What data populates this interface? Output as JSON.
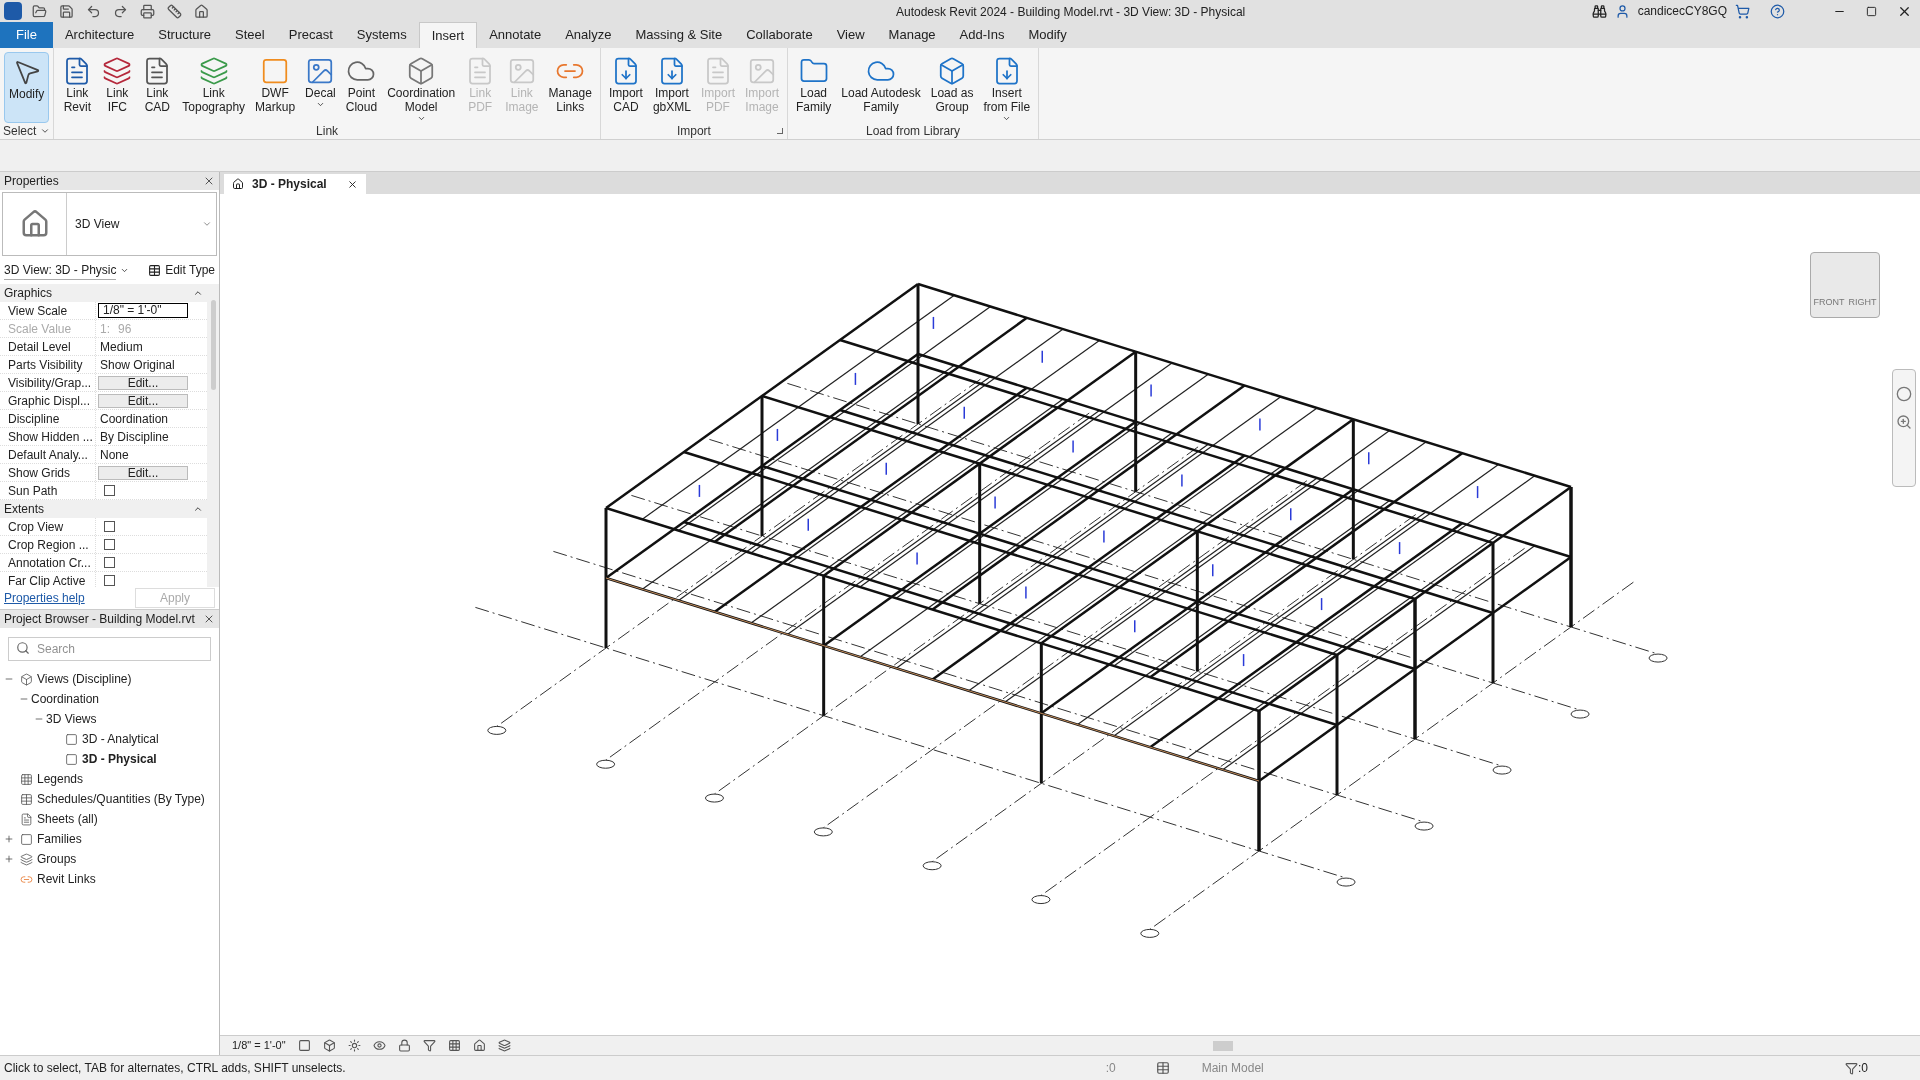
{
  "window": {
    "title": "Autodesk Revit 2024 - Building Model.rvt - 3D View: 3D - Physical",
    "user": "candicecCY8GQ"
  },
  "ribbon": {
    "tabs": [
      {
        "label": "File",
        "kind": "file",
        "selected": false
      },
      {
        "label": "Architecture",
        "kind": "tab",
        "selected": false
      },
      {
        "label": "Structure",
        "kind": "tab",
        "selected": false
      },
      {
        "label": "Steel",
        "kind": "tab",
        "selected": false
      },
      {
        "label": "Precast",
        "kind": "tab",
        "selected": false
      },
      {
        "label": "Systems",
        "kind": "tab",
        "selected": false
      },
      {
        "label": "Insert",
        "kind": "tab",
        "selected": true
      },
      {
        "label": "Annotate",
        "kind": "tab",
        "selected": false
      },
      {
        "label": "Analyze",
        "kind": "tab",
        "selected": false
      },
      {
        "label": "Massing & Site",
        "kind": "tab",
        "selected": false
      },
      {
        "label": "Collaborate",
        "kind": "tab",
        "selected": false
      },
      {
        "label": "View",
        "kind": "tab",
        "selected": false
      },
      {
        "label": "Manage",
        "kind": "tab",
        "selected": false
      },
      {
        "label": "Add-Ins",
        "kind": "tab",
        "selected": false
      },
      {
        "label": "Modify",
        "kind": "tab",
        "selected": false
      }
    ],
    "panels": [
      {
        "title": "Select",
        "launcher": false,
        "dropdown": true,
        "tools": [
          {
            "lines": [
              "Modify"
            ],
            "selected": true,
            "disabled": false,
            "dropdown": false
          }
        ]
      },
      {
        "title": "Link",
        "launcher": false,
        "dropdown": false,
        "tools": [
          {
            "lines": [
              "Link",
              "Revit"
            ],
            "selected": false,
            "disabled": false,
            "dropdown": false
          },
          {
            "lines": [
              "Link",
              "IFC"
            ],
            "selected": false,
            "disabled": false,
            "dropdown": false
          },
          {
            "lines": [
              "Link",
              "CAD"
            ],
            "selected": false,
            "disabled": false,
            "dropdown": false
          },
          {
            "lines": [
              "Link",
              "Topography"
            ],
            "selected": false,
            "disabled": false,
            "dropdown": false
          },
          {
            "lines": [
              "DWF",
              "Markup"
            ],
            "selected": false,
            "disabled": false,
            "dropdown": false
          },
          {
            "lines": [
              "Decal"
            ],
            "selected": false,
            "disabled": false,
            "dropdown": true
          },
          {
            "lines": [
              "Point",
              "Cloud"
            ],
            "selected": false,
            "disabled": false,
            "dropdown": false
          },
          {
            "lines": [
              "Coordination",
              "Model"
            ],
            "selected": false,
            "disabled": false,
            "dropdown": true
          },
          {
            "lines": [
              "Link",
              "PDF"
            ],
            "selected": false,
            "disabled": true,
            "dropdown": false
          },
          {
            "lines": [
              "Link",
              "Image"
            ],
            "selected": false,
            "disabled": true,
            "dropdown": false
          },
          {
            "lines": [
              "Manage",
              "Links"
            ],
            "selected": false,
            "disabled": false,
            "dropdown": false
          }
        ]
      },
      {
        "title": "Import",
        "launcher": true,
        "dropdown": false,
        "tools": [
          {
            "lines": [
              "Import",
              "CAD"
            ],
            "selected": false,
            "disabled": false,
            "dropdown": false
          },
          {
            "lines": [
              "Import",
              "gbXML"
            ],
            "selected": false,
            "disabled": false,
            "dropdown": false
          },
          {
            "lines": [
              "Import",
              "PDF"
            ],
            "selected": false,
            "disabled": true,
            "dropdown": false
          },
          {
            "lines": [
              "Import",
              "Image"
            ],
            "selected": false,
            "disabled": true,
            "dropdown": false
          }
        ]
      },
      {
        "title": "Load from Library",
        "launcher": false,
        "dropdown": false,
        "tools": [
          {
            "lines": [
              "Load",
              "Family"
            ],
            "selected": false,
            "disabled": false,
            "dropdown": false
          },
          {
            "lines": [
              "Load Autodesk",
              "Family"
            ],
            "selected": false,
            "disabled": false,
            "dropdown": false
          },
          {
            "lines": [
              "Load as",
              "Group"
            ],
            "selected": false,
            "disabled": false,
            "dropdown": false
          },
          {
            "lines": [
              "Insert",
              "from File"
            ],
            "selected": false,
            "disabled": false,
            "dropdown": true
          }
        ]
      }
    ]
  },
  "properties": {
    "title": "Properties",
    "type_name": "3D View",
    "selector": "3D View: 3D - Physic",
    "edit_type": "Edit Type",
    "groups": [
      {
        "name": "Graphics",
        "rows": [
          {
            "label": "View Scale",
            "kind": "field",
            "value": "1/8\" = 1'-0\""
          },
          {
            "label": "Scale Value",
            "kind": "readonly",
            "prefix": "1:",
            "value": "96"
          },
          {
            "label": "Detail Level",
            "kind": "text",
            "value": "Medium"
          },
          {
            "label": "Parts Visibility",
            "kind": "text",
            "value": "Show Original"
          },
          {
            "label": "Visibility/Grap...",
            "kind": "button",
            "value": "Edit..."
          },
          {
            "label": "Graphic Displ...",
            "kind": "button",
            "value": "Edit..."
          },
          {
            "label": "Discipline",
            "kind": "text",
            "value": "Coordination"
          },
          {
            "label": "Show Hidden ...",
            "kind": "text",
            "value": "By Discipline"
          },
          {
            "label": "Default Analy...",
            "kind": "text",
            "value": "None"
          },
          {
            "label": "Show Grids",
            "kind": "button",
            "value": "Edit..."
          },
          {
            "label": "Sun Path",
            "kind": "checkbox",
            "checked": false
          }
        ]
      },
      {
        "name": "Extents",
        "rows": [
          {
            "label": "Crop View",
            "kind": "checkbox",
            "checked": false
          },
          {
            "label": "Crop Region ...",
            "kind": "checkbox",
            "checked": false
          },
          {
            "label": "Annotation Cr...",
            "kind": "checkbox",
            "checked": false
          },
          {
            "label": "Far Clip Active",
            "kind": "checkbox",
            "checked": false
          }
        ]
      }
    ],
    "help": "Properties help",
    "apply": {
      "label": "Apply",
      "disabled": true
    }
  },
  "browser": {
    "title": "Project Browser - Building Model.rvt",
    "search": {
      "placeholder": "Search"
    },
    "tree": [
      {
        "label": "Views (Discipline)",
        "kind": "views",
        "expanded": true,
        "selected": false,
        "children": [
          {
            "label": "Coordination",
            "expanded": true,
            "selected": false,
            "children": [
              {
                "label": "3D Views",
                "expanded": true,
                "selected": false,
                "children": [
                  {
                    "label": "3D - Analytical",
                    "kind": "view",
                    "selected": false
                  },
                  {
                    "label": "3D - Physical",
                    "kind": "view",
                    "selected": true
                  }
                ]
              }
            ]
          }
        ]
      },
      {
        "label": "Legends",
        "kind": "legend",
        "selected": false
      },
      {
        "label": "Schedules/Quantities (By Type)",
        "kind": "schedule",
        "selected": false
      },
      {
        "label": "Sheets (all)",
        "kind": "sheet",
        "selected": false
      },
      {
        "label": "Families",
        "kind": "family",
        "expanded": false,
        "selected": false
      },
      {
        "label": "Groups",
        "kind": "group",
        "expanded": false,
        "selected": false
      },
      {
        "label": "Revit Links",
        "kind": "link",
        "selected": false
      }
    ]
  },
  "view": {
    "tab": "3D - Physical",
    "viewcube": [
      "FRONT",
      "RIGHT"
    ],
    "scale": "1/8\" = 1'-0\""
  },
  "status_bar": {
    "message": "Click to select, TAB for alternates, CTRL adds, SHIFT unselects.",
    "worksets": ":0",
    "model": "Main Model",
    "filter": ":0"
  }
}
